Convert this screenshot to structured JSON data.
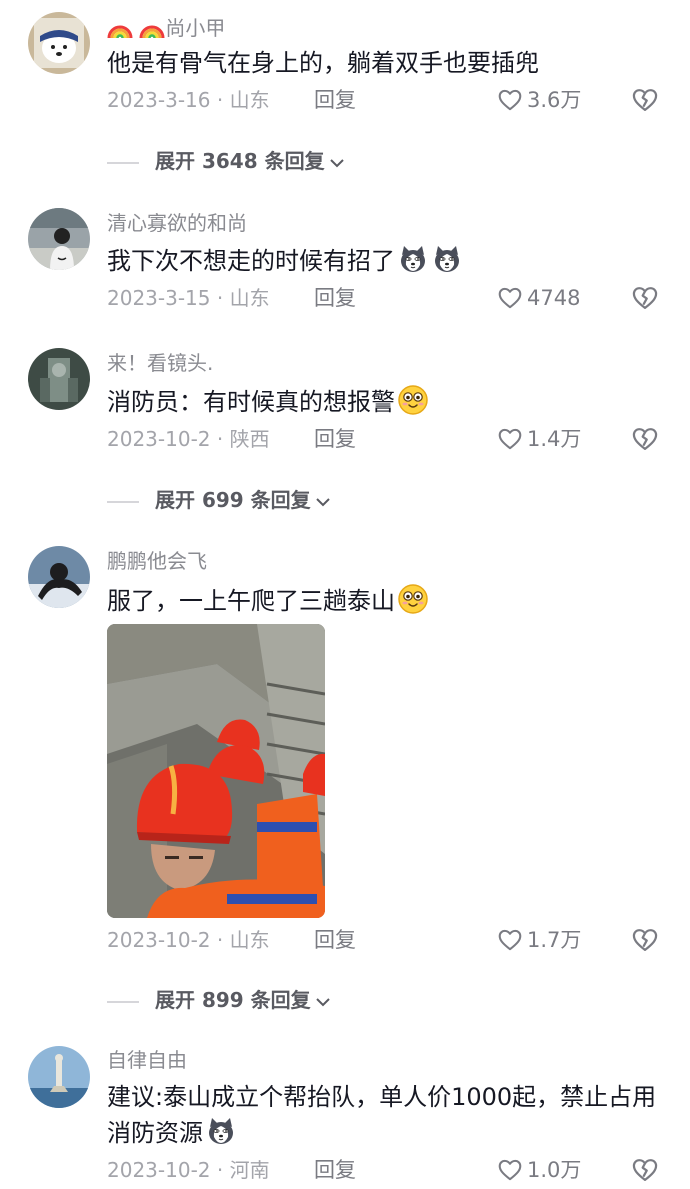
{
  "comments": [
    {
      "username_prefix_icons": [
        "rainbow-icon",
        "rainbow-icon"
      ],
      "username": "尚小甲",
      "text": "他是有骨气在身上的，躺着双手也要插兜",
      "date_location": "2023-3-16 · 山东",
      "reply_label": "回复",
      "likes": "3.6万",
      "expand_label": "展开 3648 条回复"
    },
    {
      "username": "清心寡欲的和尚",
      "text": "我下次不想走的时候有招了",
      "text_emojis": [
        "husky-emoji",
        "husky-emoji"
      ],
      "date_location": "2023-3-15 · 山东",
      "reply_label": "回复",
      "likes": "4748"
    },
    {
      "username": "来！看镜头.",
      "text": "消防员：有时候真的想报警",
      "text_emojis": [
        "smile-emoji"
      ],
      "date_location": "2023-10-2 · 陕西",
      "reply_label": "回复",
      "likes": "1.4万",
      "expand_label": "展开 699 条回复"
    },
    {
      "username": "鹏鹏他会飞",
      "text": "服了，一上午爬了三趟泰山",
      "text_emojis": [
        "smile-emoji"
      ],
      "image": "firefighters-on-stairs-photo",
      "date_location": "2023-10-2 · 山东",
      "reply_label": "回复",
      "likes": "1.7万",
      "expand_label": "展开 899 条回复"
    },
    {
      "username": "自律自由",
      "text": "建议:泰山成立个帮抬队，单人价1000起，禁止占用消防资源",
      "text_emojis": [
        "husky-emoji"
      ],
      "date_location": "2023-10-2 · 河南",
      "reply_label": "回复",
      "likes": "1.0万"
    }
  ],
  "colors": {
    "username": "#8a8b91",
    "meta": "#a3a4aa",
    "text": "#161823",
    "helmet": "#e8321f",
    "uniform": "#f0601e"
  }
}
